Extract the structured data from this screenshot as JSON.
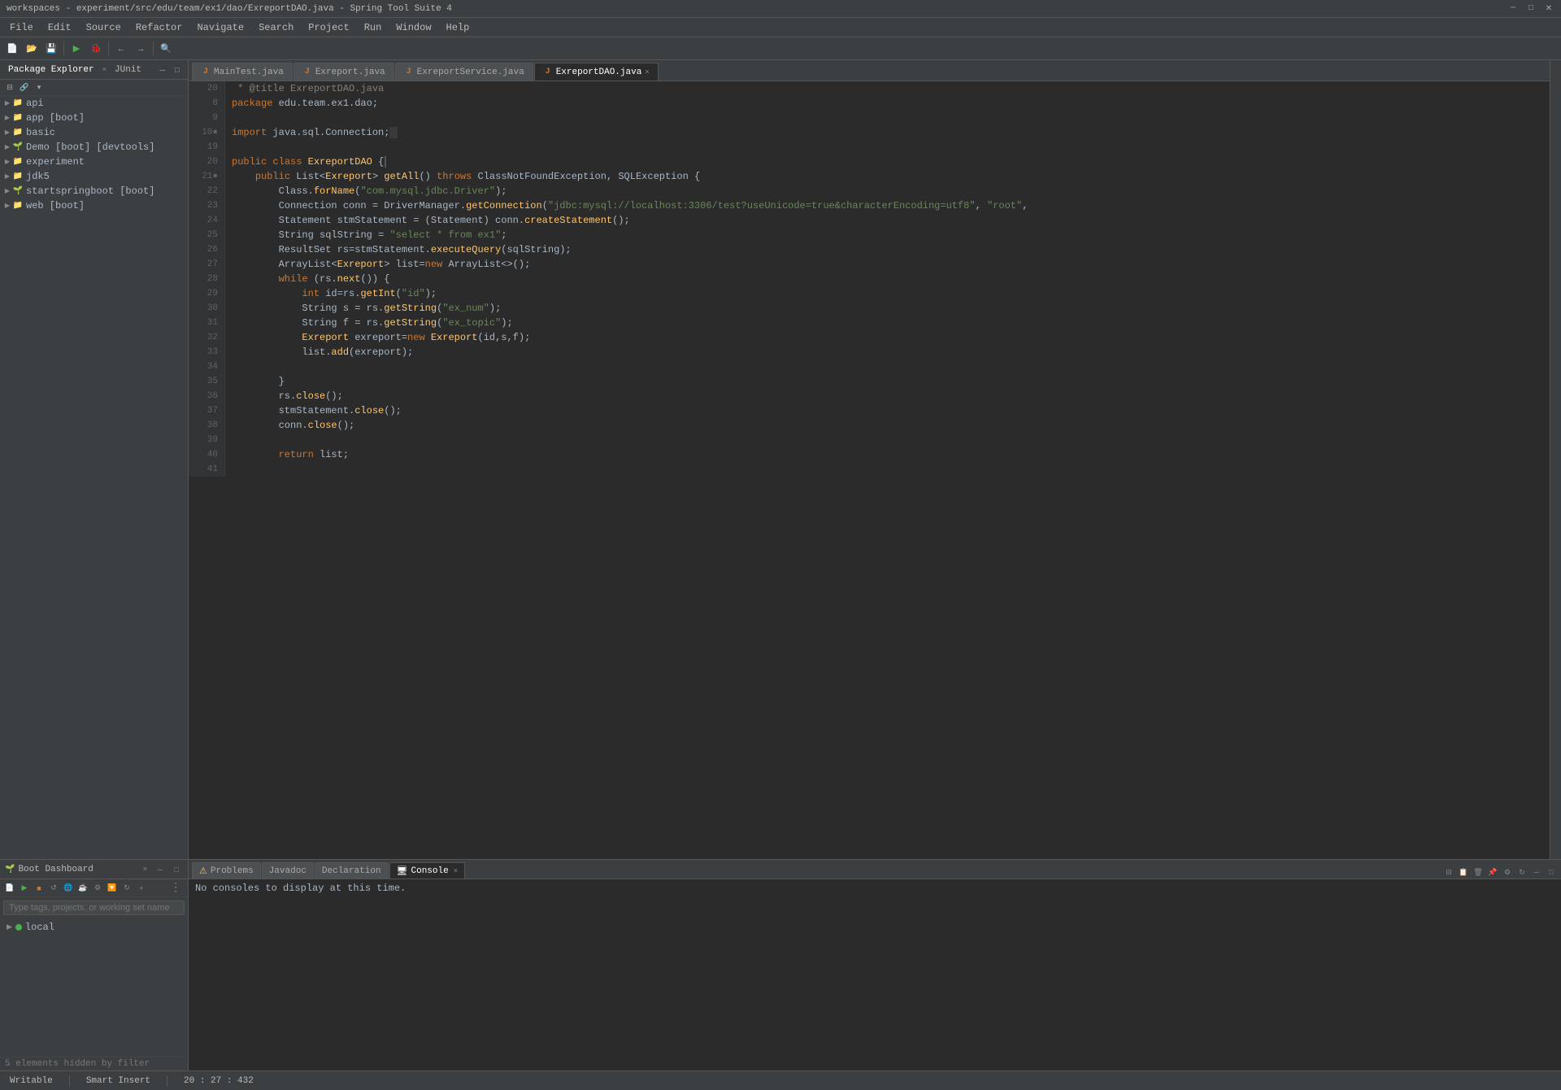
{
  "title_bar": {
    "title": "workspaces - experiment/src/edu/team/ex1/dao/ExreportDAO.java - Spring Tool Suite 4",
    "minimize": "─",
    "maximize": "□",
    "close": "✕"
  },
  "menu": {
    "items": [
      "File",
      "Edit",
      "Source",
      "Refactor",
      "Navigate",
      "Search",
      "Project",
      "Run",
      "Window",
      "Help"
    ]
  },
  "package_explorer": {
    "header": "Package Explorer",
    "tab2": "JUnit",
    "close_symbol": "×",
    "tree": [
      {
        "label": "api",
        "level": 1,
        "icon": "📁",
        "has_arrow": true,
        "arrow": "▶"
      },
      {
        "label": "app [boot]",
        "level": 1,
        "icon": "📁",
        "has_arrow": true,
        "arrow": "▶"
      },
      {
        "label": "basic",
        "level": 1,
        "icon": "📁",
        "has_arrow": true,
        "arrow": "▶"
      },
      {
        "label": "Demo [boot] [devtools]",
        "level": 1,
        "icon": "🌱",
        "has_arrow": true,
        "arrow": "▶"
      },
      {
        "label": "experiment",
        "level": 1,
        "icon": "📁",
        "has_arrow": true,
        "arrow": "▶"
      },
      {
        "label": "jdk5",
        "level": 1,
        "icon": "📁",
        "has_arrow": true,
        "arrow": "▶"
      },
      {
        "label": "startspringboot [boot]",
        "level": 1,
        "icon": "🌱",
        "has_arrow": true,
        "arrow": "▶"
      },
      {
        "label": "web [boot]",
        "level": 1,
        "icon": "📁",
        "has_arrow": true,
        "arrow": "▶"
      }
    ]
  },
  "editor_tabs": [
    {
      "label": "MainTest.java",
      "active": false,
      "closeable": false,
      "icon": "J"
    },
    {
      "label": "Exreport.java",
      "active": false,
      "closeable": false,
      "icon": "J"
    },
    {
      "label": "ExreportService.java",
      "active": false,
      "closeable": false,
      "icon": "J"
    },
    {
      "label": "ExreportDAO.java",
      "active": true,
      "closeable": true,
      "icon": "J"
    }
  ],
  "code": {
    "filename": "ExreportDAO.java",
    "lines": [
      {
        "num": "20",
        "content": " * @title ExreportDAO.java",
        "special": "comment"
      },
      {
        "num": "8",
        "content": "package edu.team.ex1.dao;",
        "special": "package"
      },
      {
        "num": "9",
        "content": "",
        "special": "blank"
      },
      {
        "num": "10",
        "content": "import java.sql.Connection;",
        "special": "import"
      },
      {
        "num": "19",
        "content": "",
        "special": "blank"
      },
      {
        "num": "20",
        "content": "public class ExreportDAO {",
        "special": "class-decl"
      },
      {
        "num": "21",
        "content": "    public List<Exreport> getAll() throws ClassNotFoundException, SQLException {",
        "special": "method"
      },
      {
        "num": "22",
        "content": "        Class.forName(\"com.mysql.jdbc.Driver\");",
        "special": "stmt"
      },
      {
        "num": "23",
        "content": "        Connection conn = DriverManager.getConnection(\"jdbc:mysql://localhost:3306/test?useUnicode=true&characterEncoding=utf8\", \"root\",",
        "special": "stmt"
      },
      {
        "num": "24",
        "content": "        Statement stmStatement = (Statement) conn.createStatement();",
        "special": "stmt"
      },
      {
        "num": "25",
        "content": "        String sqlString = \"select * from ex1\";",
        "special": "stmt"
      },
      {
        "num": "26",
        "content": "        ResultSet rs=stmStatement.executeQuery(sqlString);",
        "special": "stmt"
      },
      {
        "num": "27",
        "content": "        ArrayList<Exreport> list=new ArrayList<>();",
        "special": "stmt"
      },
      {
        "num": "28",
        "content": "        while (rs.next()) {",
        "special": "stmt"
      },
      {
        "num": "29",
        "content": "            int id=rs.getInt(\"id\");",
        "special": "stmt"
      },
      {
        "num": "30",
        "content": "            String s = rs.getString(\"ex_num\");",
        "special": "stmt"
      },
      {
        "num": "31",
        "content": "            String f = rs.getString(\"ex_topic\");",
        "special": "stmt"
      },
      {
        "num": "32",
        "content": "            Exreport exreport=new Exreport(id,s,f);",
        "special": "stmt"
      },
      {
        "num": "33",
        "content": "            list.add(exreport);",
        "special": "stmt"
      },
      {
        "num": "34",
        "content": "",
        "special": "blank"
      },
      {
        "num": "35",
        "content": "        }",
        "special": "stmt"
      },
      {
        "num": "36",
        "content": "        rs.close();",
        "special": "stmt"
      },
      {
        "num": "37",
        "content": "        stmStatement.close();",
        "special": "stmt"
      },
      {
        "num": "38",
        "content": "        conn.close();",
        "special": "stmt"
      },
      {
        "num": "39",
        "content": "",
        "special": "blank"
      },
      {
        "num": "40",
        "content": "        return list;",
        "special": "stmt"
      },
      {
        "num": "41",
        "content": "",
        "special": "blank"
      }
    ]
  },
  "bottom_panels": {
    "boot_dashboard": {
      "label": "Boot Dashboard",
      "close": "×",
      "search_placeholder": "Type tags, projects, or working set name",
      "items": [
        {
          "label": "local",
          "expanded": false
        }
      ],
      "footer": "5 elements hidden by filter"
    },
    "tabs": [
      {
        "label": "Problems",
        "active": false,
        "icon": "⚠"
      },
      {
        "label": "Javadoc",
        "active": false,
        "icon": ""
      },
      {
        "label": "Declaration",
        "active": false,
        "icon": ""
      },
      {
        "label": "Console",
        "active": true,
        "icon": "🖥",
        "closeable": true
      }
    ],
    "console_message": "No consoles to display at this time."
  },
  "status_bar": {
    "writable": "Writable",
    "insert_mode": "Smart Insert",
    "position": "20 : 27 : 432"
  }
}
